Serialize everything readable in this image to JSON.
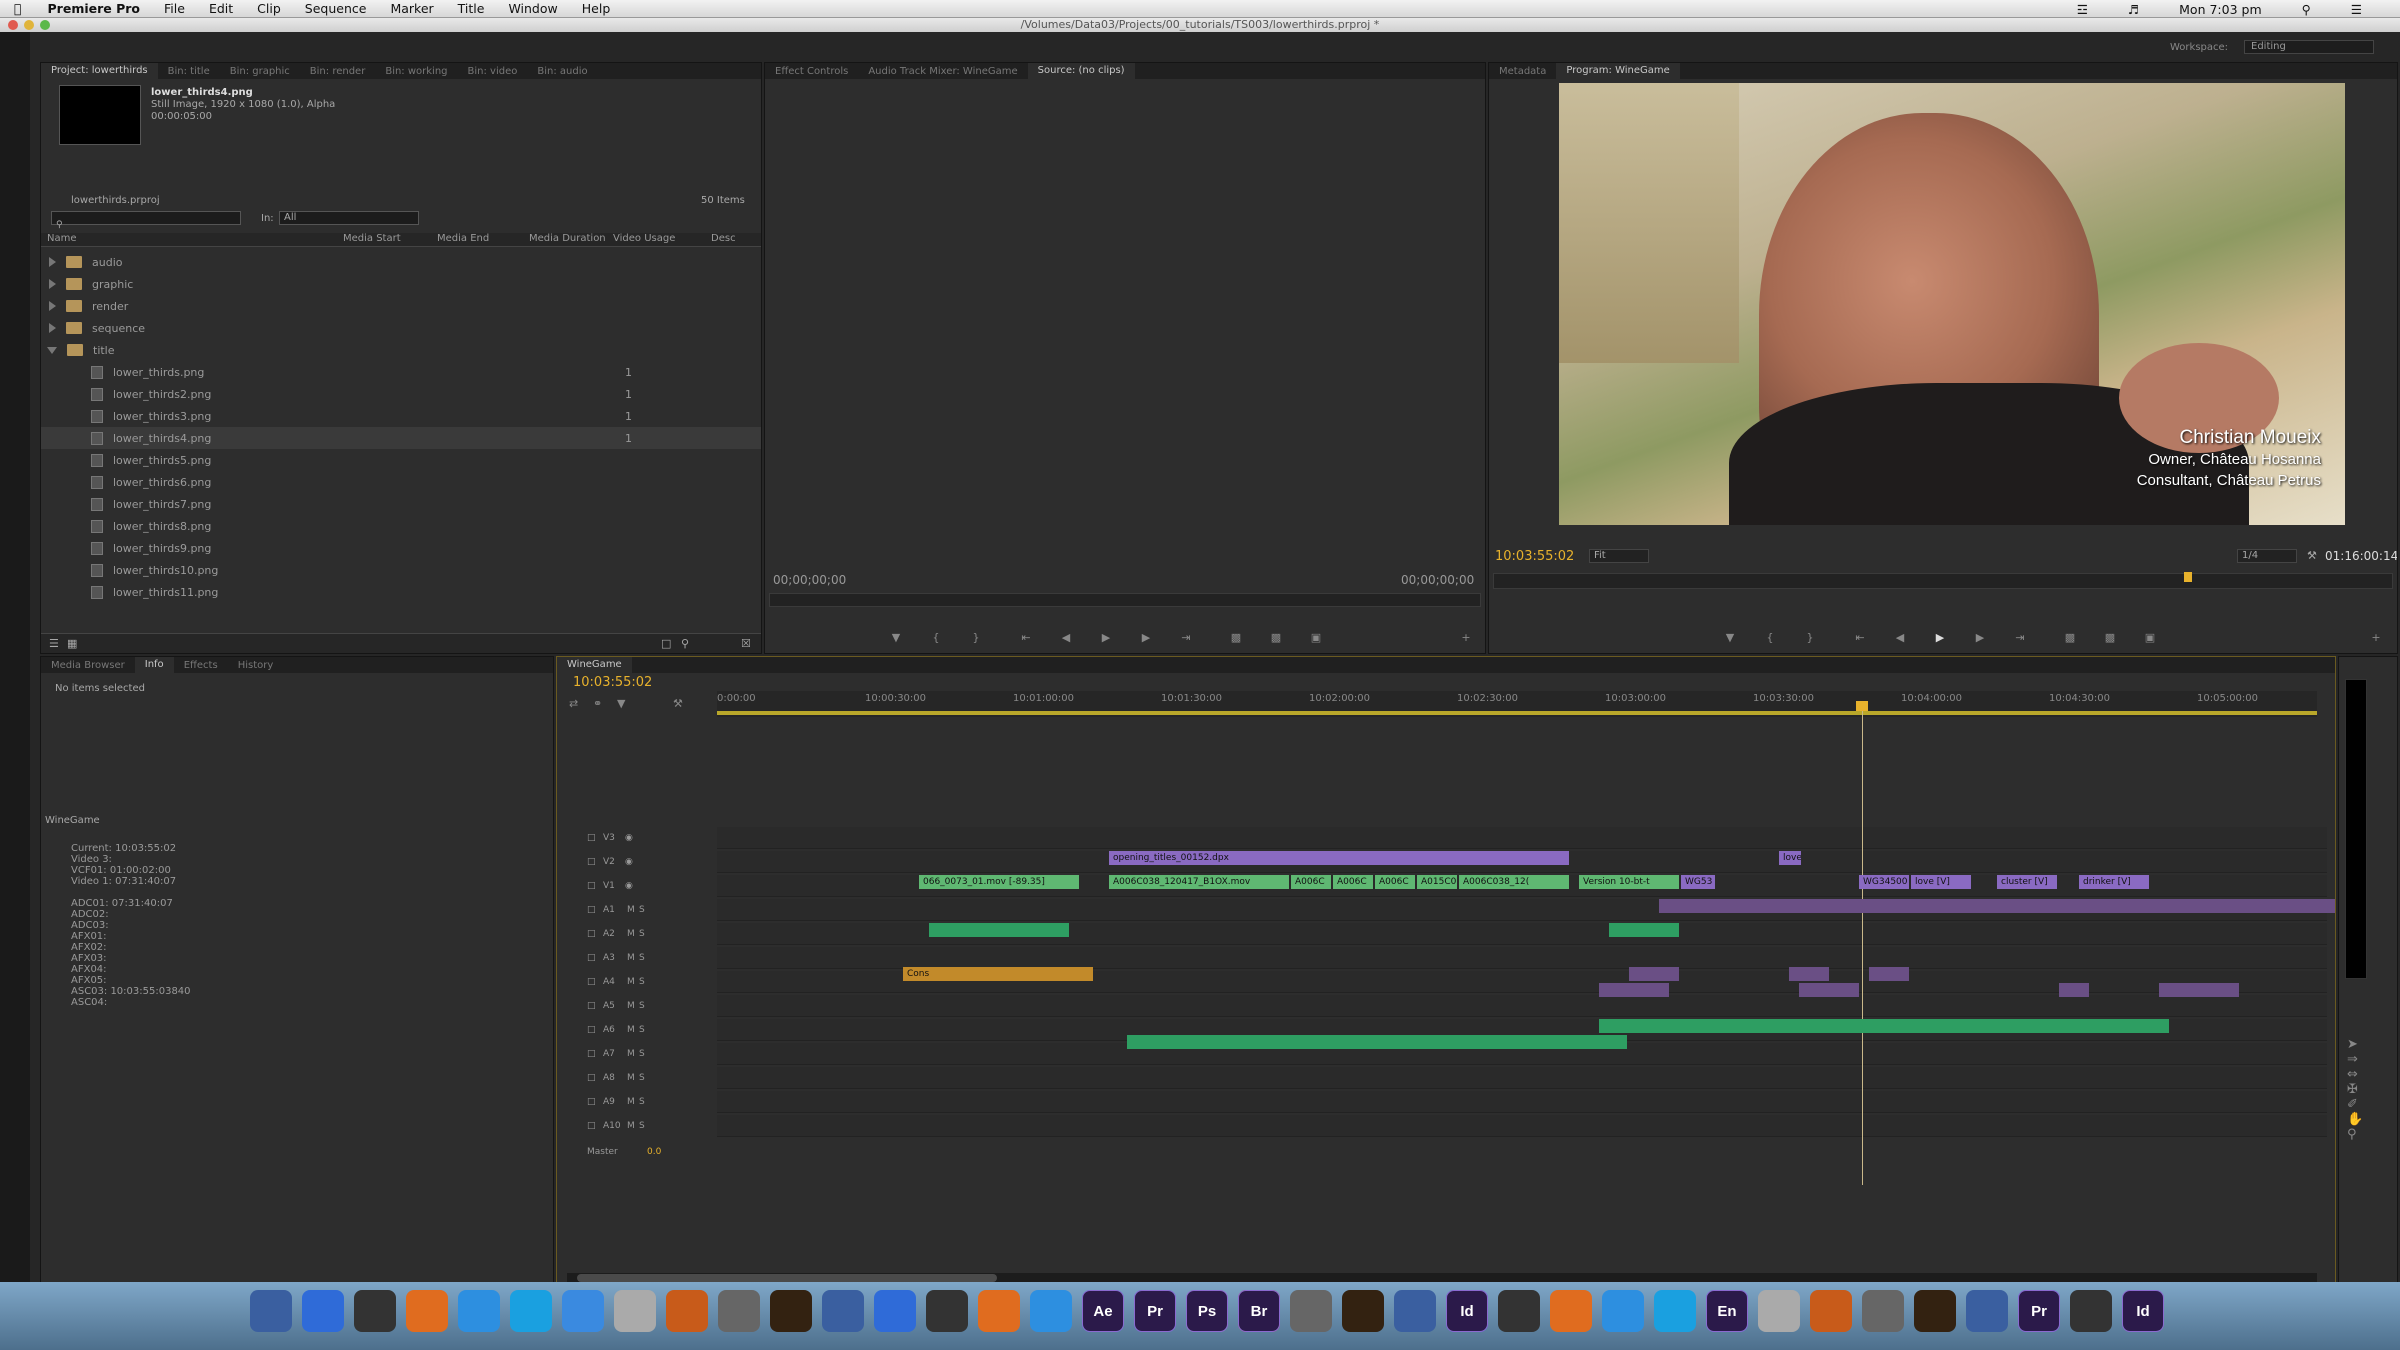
{
  "menubar": {
    "app": "Premiere Pro",
    "items": [
      "File",
      "Edit",
      "Clip",
      "Sequence",
      "Marker",
      "Title",
      "Window",
      "Help"
    ],
    "clock": "Mon 7:03 pm"
  },
  "window": {
    "path": "/Volumes/Data03/Projects/00_tutorials/TS003/lowerthirds.prproj *",
    "workspace_label": "Workspace:",
    "workspace": "Editing"
  },
  "project": {
    "tabs": [
      "Project: lowerthirds",
      "Bin: title",
      "Bin: graphic",
      "Bin: render",
      "Bin: working",
      "Bin: video",
      "Bin: audio"
    ],
    "preview": {
      "name": "lower_thirds4.png",
      "info1": "Still Image, 1920 x 1080 (1.0), Alpha",
      "info2": "00:00:05:00"
    },
    "proj_file": "lowerthirds.prproj",
    "count": "50 Items",
    "in_label": "In:",
    "in_value": "All",
    "columns": [
      "Name",
      "Media Start",
      "Media End",
      "Media Duration",
      "Video Usage",
      "Desc"
    ],
    "folders": [
      "audio",
      "graphic",
      "render",
      "sequence",
      "title"
    ],
    "files": [
      {
        "name": "lower_thirds.png",
        "usage": "1"
      },
      {
        "name": "lower_thirds2.png",
        "usage": "1"
      },
      {
        "name": "lower_thirds3.png",
        "usage": "1"
      },
      {
        "name": "lower_thirds4.png",
        "usage": "1"
      },
      {
        "name": "lower_thirds5.png",
        "usage": ""
      },
      {
        "name": "lower_thirds6.png",
        "usage": ""
      },
      {
        "name": "lower_thirds7.png",
        "usage": ""
      },
      {
        "name": "lower_thirds8.png",
        "usage": ""
      },
      {
        "name": "lower_thirds9.png",
        "usage": ""
      },
      {
        "name": "lower_thirds10.png",
        "usage": ""
      },
      {
        "name": "lower_thirds11.png",
        "usage": ""
      }
    ]
  },
  "source": {
    "tabs": [
      "Effect Controls",
      "Audio Track Mixer: WineGame",
      "Source: (no clips)"
    ],
    "tc_left": "00;00;00;00",
    "tc_right": "00;00;00;00"
  },
  "program": {
    "tabs": [
      "Metadata",
      "Program: WineGame"
    ],
    "tc": "10:03:55:02",
    "fit": "Fit",
    "res": "1/4",
    "duration": "01:16:00:14",
    "lower": {
      "name": "Christian Moueix",
      "line1": "Owner, Château Hosanna",
      "line2": "Consultant, Château Petrus"
    }
  },
  "info": {
    "tabs": [
      "Media Browser",
      "Info",
      "Effects",
      "History"
    ],
    "none": "No items selected",
    "seq": "WineGame",
    "lines": [
      "Current: 10:03:55:02",
      "Video 3:",
      "VCF01: 01:00:02:00",
      "Video 1: 07:31:40:07",
      "",
      "ADC01: 07:31:40:07",
      "ADC02:",
      "ADC03:",
      "AFX01:",
      "AFX02:",
      "AFX03:",
      "AFX04:",
      "AFX05:",
      "ASC03: 10:03:55:03840",
      "ASC04:"
    ]
  },
  "timeline": {
    "tab": "WineGame",
    "tc": "10:03:55:02",
    "ruler": [
      "0:00:00",
      "10:00:30:00",
      "10:01:00:00",
      "10:01:30:00",
      "10:02:00:00",
      "10:02:30:00",
      "10:03:00:00",
      "10:03:30:00",
      "10:04:00:00",
      "10:04:30:00",
      "10:05:00:00"
    ],
    "video_tracks": [
      "V3",
      "V2",
      "V1"
    ],
    "audio_tracks": [
      "A1",
      "A2",
      "A3",
      "A4",
      "A5",
      "A6",
      "A7",
      "A8",
      "A9",
      "A10"
    ],
    "master": "Master",
    "master_val": "0.0",
    "clips": {
      "opening": "opening_titles_00152.dpx",
      "v1a": "066_0073_01.mov [-89.35]",
      "v1b": "A006C038_120417_B1OX.mov",
      "v1c": "A006C",
      "v1d": "A006C",
      "v1e": "A006C",
      "v1f": "A015C0",
      "v1g": "A006C038_12(",
      "v1h": "Version 10-bt-t",
      "v1i": "WG53",
      "v1j": "WG34500",
      "v1k": "love [V]",
      "v1l": "cluster [V]",
      "v1m": "drinker [V]",
      "love": "love",
      "a6": "Cons"
    }
  },
  "dock": [
    "Ae",
    "Pr",
    "Ps",
    "Br",
    "Id",
    "En",
    "Pr",
    "Id"
  ]
}
